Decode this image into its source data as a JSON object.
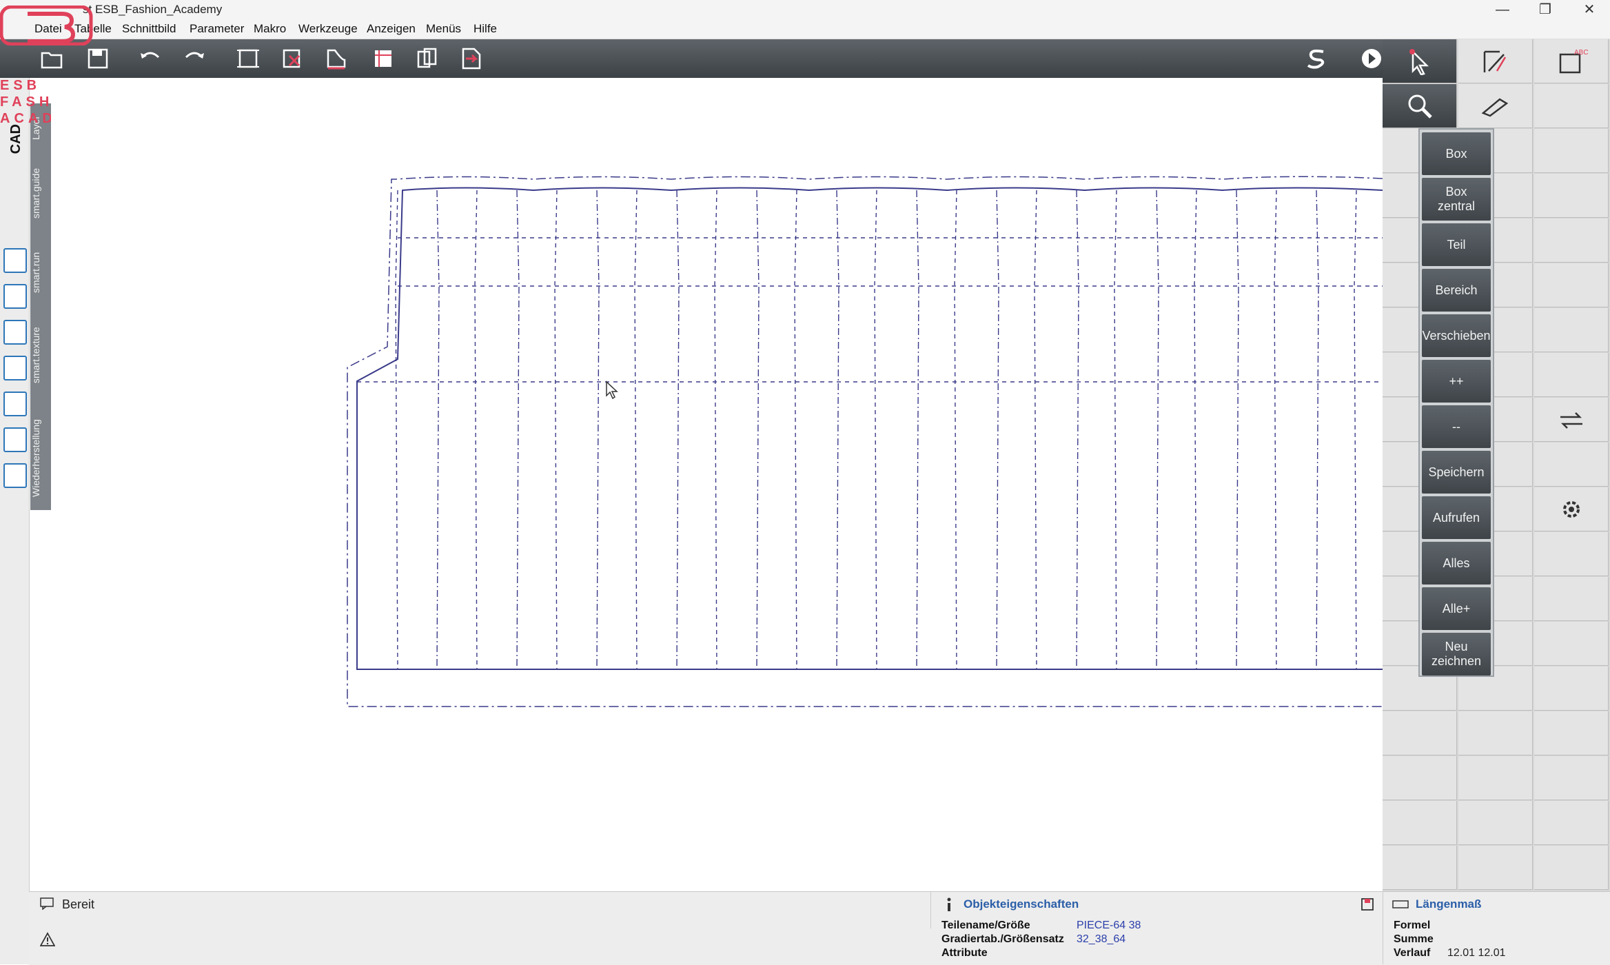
{
  "window": {
    "title": "st  ESB_Fashion_Academy",
    "controls": [
      "—",
      "❐",
      "✕"
    ]
  },
  "logo": {
    "lines": [
      "ESB",
      "FASHION",
      "ACADEMY"
    ]
  },
  "menu": {
    "items": [
      "Datei",
      "Tabelle",
      "Schnittbild",
      "Parameter",
      "Makro",
      "Werkzeuge",
      "Anzeigen",
      "Menüs",
      "Hilfe"
    ]
  },
  "left_panel": {
    "cad_label": "CAD",
    "tabs": [
      "Layer",
      "smart.guide",
      "smart.run",
      "smart.texture",
      "Wiederherstellung"
    ]
  },
  "popup_menu": {
    "items": [
      "Box",
      "Box\nzentral",
      "Teil",
      "Bereich",
      "Verschieben",
      "++",
      "--",
      "Speichern",
      "Aufrufen",
      "Alles",
      "Alle+",
      "Neu\nzeichnen"
    ]
  },
  "status": {
    "message": "Bereit"
  },
  "object_properties": {
    "title": "Objekteigenschaften",
    "rows": [
      {
        "key": "Teilename/Größe",
        "value": "PIECE-64 38"
      },
      {
        "key": "Gradiertab./Größensatz",
        "value": "32_38_64"
      },
      {
        "key": "Attribute",
        "value": ""
      }
    ]
  },
  "length_measure": {
    "title": "Längenmaß",
    "rows": [
      {
        "key": "Formel",
        "value": ""
      },
      {
        "key": "Summe",
        "value": ""
      },
      {
        "key": "Verlauf",
        "value": "12.01 12.01"
      }
    ]
  },
  "colors": {
    "accent": "#e0415a",
    "toolbar": "#4a5055",
    "pattern_line": "#3a3a8a",
    "link_blue": "#2b5ea8"
  }
}
